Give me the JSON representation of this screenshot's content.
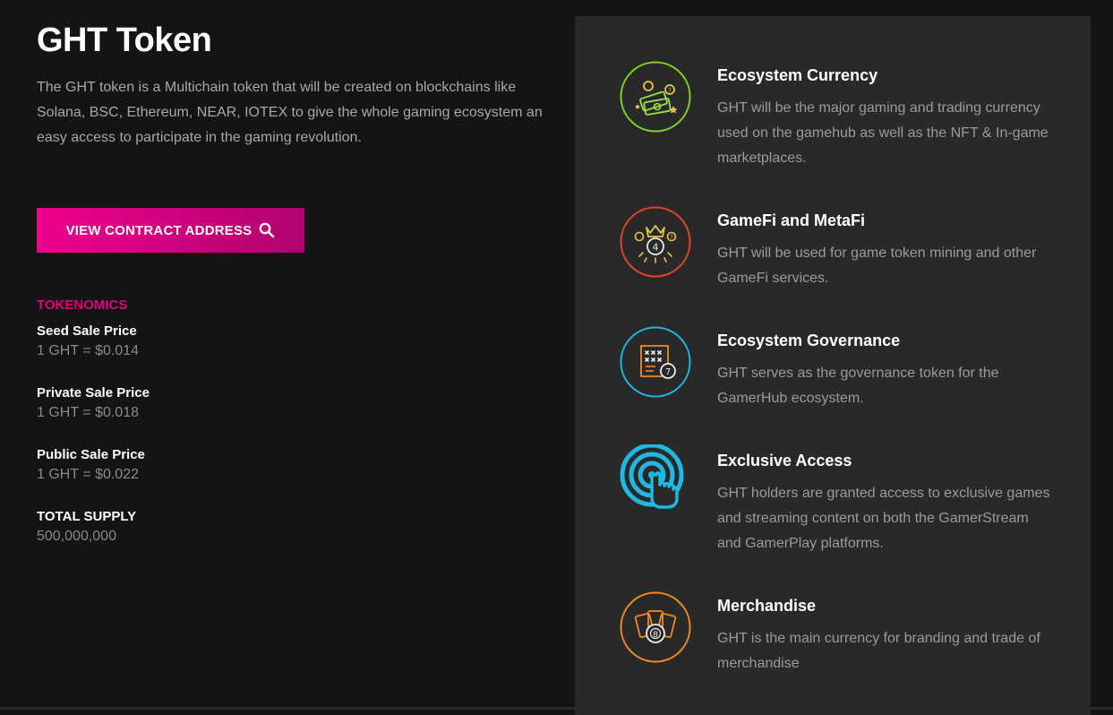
{
  "header": {
    "title": "GHT Token",
    "intro": "The GHT token is a Multichain token that will be created on blockchains like Solana, BSC, Ethereum, NEAR, IOTEX to give the whole gaming ecosystem an easy access to participate in the gaming revolution."
  },
  "contract_button": {
    "label": "VIEW CONTRACT ADDRESS",
    "icon": "search-icon"
  },
  "tokenomics": {
    "heading": "TOKENOMICS",
    "items": [
      {
        "label": "Seed Sale Price",
        "value": "1 GHT = $0.014"
      },
      {
        "label": "Private Sale Price",
        "value": "1 GHT = $0.018"
      },
      {
        "label": "Public Sale Price",
        "value": "1 GHT = $0.022"
      },
      {
        "label": "TOTAL SUPPLY",
        "value": "500,000,000"
      }
    ]
  },
  "features": [
    {
      "title": "Ecosystem Currency",
      "description": "GHT will be the major gaming and trading currency used on the gamehub as well as the NFT & In-game marketplaces.",
      "icon": "money-icon",
      "ring_color": "#7ed321"
    },
    {
      "title": "GameFi and MetaFi",
      "description": "GHT will be used for game token mining and other GameFi services.",
      "icon": "crown-ball-icon",
      "ring_color": "#e0452a"
    },
    {
      "title": "Ecosystem Governance",
      "description": "GHT serves as the governance token for the GamerHub ecosystem.",
      "icon": "ballot-ticket-icon",
      "ring_color": "#1fb8e0"
    },
    {
      "title": "Exclusive Access",
      "description": "GHT holders are granted access to exclusive games and streaming content on both the GamerStream and GamerPlay platforms.",
      "icon": "tap-hand-icon",
      "ring_color": "#1fb8e0"
    },
    {
      "title": "Merchandise",
      "description": "GHT is the main currency for branding and trade of merchandise",
      "icon": "tickets-icon",
      "ring_color": "#f08a24"
    }
  ],
  "colors": {
    "accent": "#e6007e",
    "background": "#141414",
    "panel": "#292929"
  }
}
